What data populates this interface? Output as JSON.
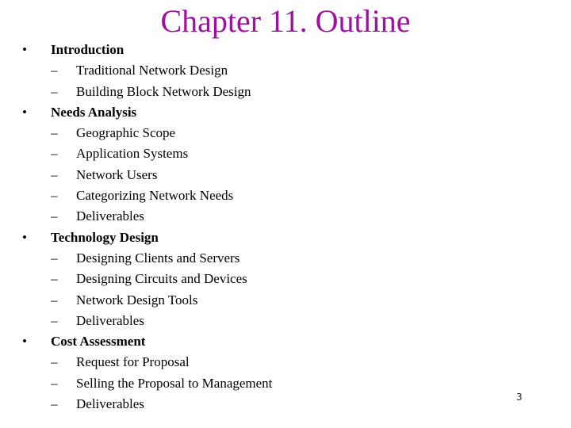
{
  "slide": {
    "title": "Chapter 11. Outline",
    "page_number": "3",
    "title_color": "#a010a0",
    "bullet_glyph": "•",
    "dash_glyph": "–",
    "sections": [
      {
        "label": "Introduction",
        "items": [
          "Traditional Network Design",
          "Building Block Network Design"
        ]
      },
      {
        "label": "Needs Analysis",
        "items": [
          "Geographic Scope",
          "Application Systems",
          "Network Users",
          "Categorizing Network Needs",
          "Deliverables"
        ]
      },
      {
        "label": "Technology Design",
        "items": [
          "Designing Clients and Servers",
          "Designing Circuits and Devices",
          "Network Design Tools",
          "Deliverables"
        ]
      },
      {
        "label": "Cost Assessment",
        "items": [
          "Request for Proposal",
          "Selling the Proposal to Management",
          "Deliverables"
        ]
      }
    ]
  }
}
